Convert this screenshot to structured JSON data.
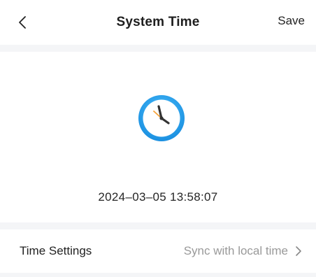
{
  "header": {
    "title": "System Time",
    "save_label": "Save"
  },
  "clock": {
    "datetime": "2024–03–05 13:58:07"
  },
  "settings": {
    "label": "Time Settings",
    "value": "Sync with local time"
  },
  "colors": {
    "clock_ring": "#1da1f2",
    "clock_hands": "#333333",
    "second_hand": "#f5a23a"
  }
}
